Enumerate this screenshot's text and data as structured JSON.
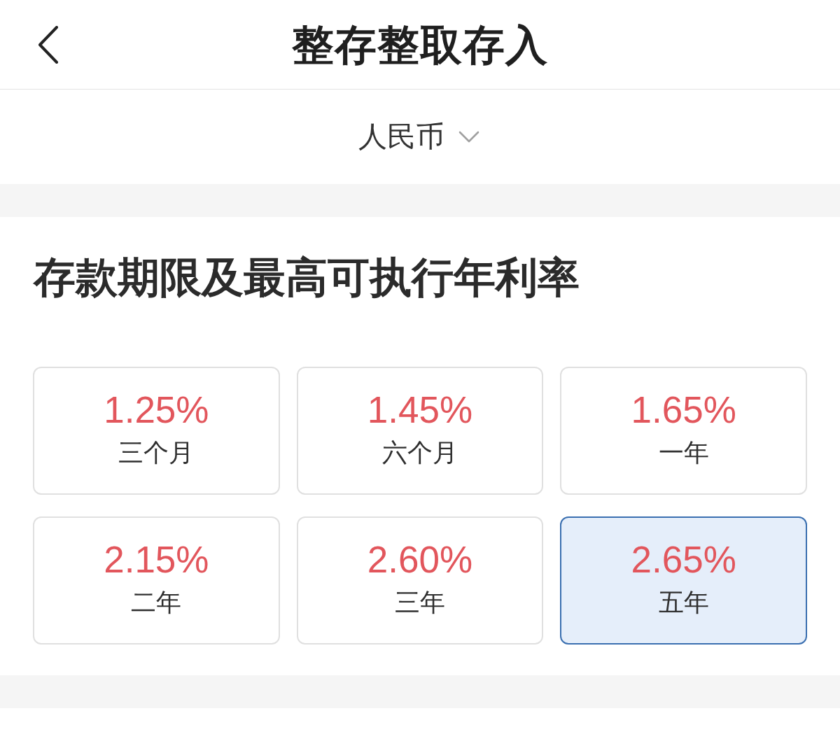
{
  "header": {
    "title": "整存整取存入"
  },
  "currency": {
    "label": "人民币"
  },
  "section": {
    "title": "存款期限及最高可执行年利率"
  },
  "terms": [
    {
      "rate": "1.25%",
      "term": "三个月",
      "selected": false
    },
    {
      "rate": "1.45%",
      "term": "六个月",
      "selected": false
    },
    {
      "rate": "1.65%",
      "term": "一年",
      "selected": false
    },
    {
      "rate": "2.15%",
      "term": "二年",
      "selected": false
    },
    {
      "rate": "2.60%",
      "term": "三年",
      "selected": false
    },
    {
      "rate": "2.65%",
      "term": "五年",
      "selected": true
    }
  ]
}
